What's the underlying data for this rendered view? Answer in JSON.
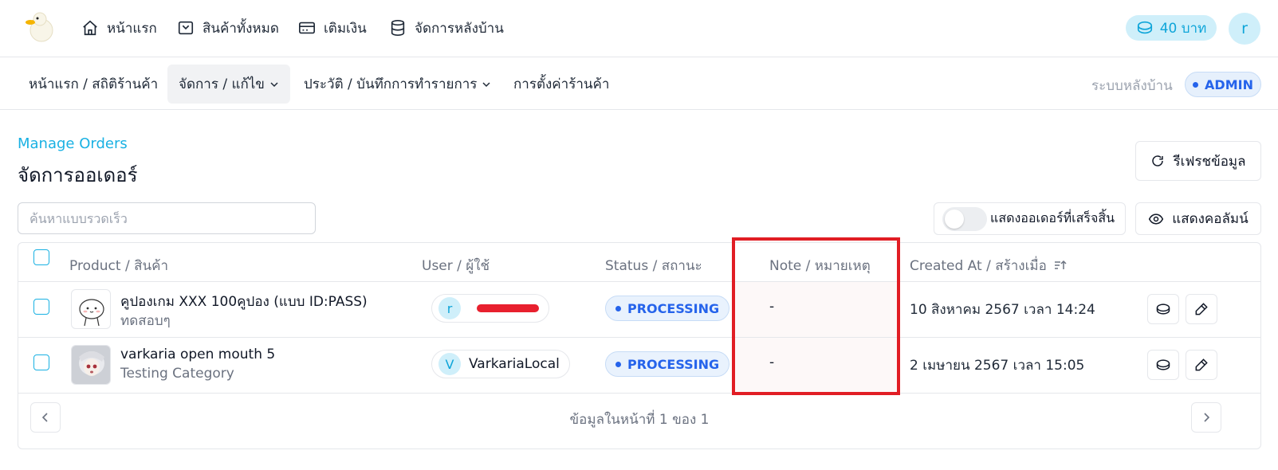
{
  "topnav": {
    "links": [
      {
        "label": "หน้าแรก",
        "icon": "home-icon"
      },
      {
        "label": "สินค้าทั้งหมด",
        "icon": "package-icon"
      },
      {
        "label": "เติมเงิน",
        "icon": "credit-card-icon"
      },
      {
        "label": "จัดการหลังบ้าน",
        "icon": "database-icon"
      }
    ],
    "balance": "40 บาท",
    "user_initial": "r"
  },
  "subnav": {
    "items": [
      {
        "label": "หน้าแรก / สถิติร้านค้า"
      },
      {
        "label": "จัดการ / แก้ไข"
      },
      {
        "label": "ประวัติ / บันทึกการทำรายการ"
      },
      {
        "label": "การตั้งค่าร้านค้า"
      }
    ],
    "system_label": "ระบบหลังบ้าน",
    "role_badge": "ADMIN"
  },
  "page": {
    "eyebrow": "Manage Orders",
    "title": "จัดการออเดอร์",
    "refresh_label": "รีเฟรชข้อมูล"
  },
  "toolbar": {
    "search_placeholder": "ค้นหาแบบรวดเร็ว",
    "show_completed_label": "แสดงออเดอร์ที่เสร็จสิ้น",
    "show_completed": false,
    "columns_label": "แสดงคอลัมน์"
  },
  "table": {
    "headers": {
      "product": "Product / สินค้า",
      "user": "User / ผู้ใช้",
      "status": "Status / สถานะ",
      "note": "Note / หมายเหตุ",
      "created": "Created At / สร้างเมื่อ"
    },
    "rows": [
      {
        "product_name": "คูปองเกม XXX 100คูปอง (แบบ ID:PASS)",
        "product_category": "ทดสอบๆ",
        "user_initial": "r",
        "user_name": "",
        "status": "PROCESSING",
        "note": "-",
        "created_at": "10 สิงหาคม 2567 เวลา 14:24"
      },
      {
        "product_name": "varkaria open mouth 5",
        "product_category": "Testing Category",
        "user_initial": "V",
        "user_name": "VarkariaLocal",
        "status": "PROCESSING",
        "note": "-",
        "created_at": "2 เมษายน 2567 เวลา 15:05"
      }
    ],
    "pagination": "ข้อมูลในหน้าที่ 1 ของ 1"
  },
  "colors": {
    "accent": "#19b1e3",
    "status_blue": "#2563eb",
    "highlight": "#e11d24",
    "redaction": "#e8202e"
  }
}
